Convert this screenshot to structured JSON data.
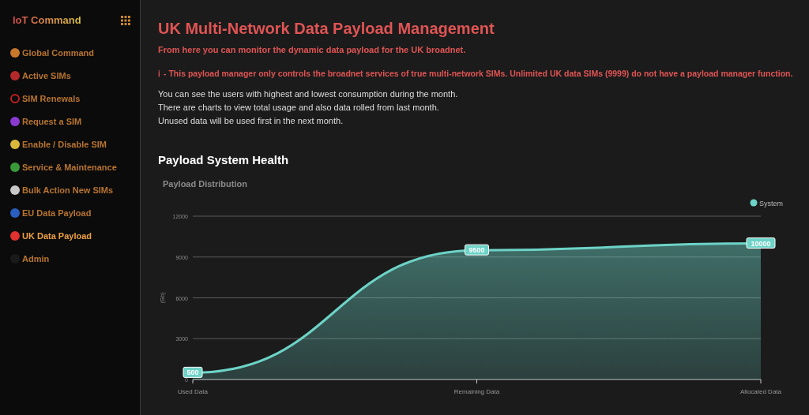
{
  "sidebar": {
    "brand": "IoT Command",
    "items": [
      {
        "label": "Global Command",
        "kind": "dot",
        "color": "#c8782a",
        "selected": false
      },
      {
        "label": "Active SIMs",
        "kind": "dot",
        "color": "#b42a2a",
        "selected": false
      },
      {
        "label": "SIM Renewals",
        "kind": "ring",
        "color": "#c02020",
        "selected": false
      },
      {
        "label": "Request a SIM",
        "kind": "dot",
        "color": "#8a3ad0",
        "selected": false
      },
      {
        "label": "Enable / Disable SIM",
        "kind": "dot",
        "color": "#d8b83a",
        "selected": false
      },
      {
        "label": "Service & Maintenance",
        "kind": "dot",
        "color": "#3a9a3a",
        "selected": false
      },
      {
        "label": "Bulk Action New SIMs",
        "kind": "dot",
        "color": "#c8c8c8",
        "selected": false
      },
      {
        "label": "EU Data Payload",
        "kind": "dot",
        "color": "#2a5ec0",
        "selected": false
      },
      {
        "label": "UK Data Payload",
        "kind": "dot",
        "color": "#e03030",
        "selected": true
      },
      {
        "label": "Admin",
        "kind": "dot",
        "color": "#1a1a1a",
        "selected": false
      }
    ]
  },
  "page": {
    "title": "UK Multi-Network Data Payload Management",
    "intro": "From here you can monitor the dynamic data payload for the UK broadnet.",
    "note_icon": "ℹ",
    "note": "- This payload manager only controls the broadnet services of true multi-network SIMs. Unlimited UK data SIMs (9999) do not have a payload manager function.",
    "lines": [
      "You can see the users with highest and lowest consumption during the month.",
      "There are charts to view total usage and also data rolled from last month.",
      "Unused data will be used first in the next month."
    ]
  },
  "health": {
    "heading": "Payload System Health",
    "chart_data": {
      "type": "area",
      "title": "Payload Distribution",
      "ylabel": "(Gb)",
      "categories": [
        "Used Data",
        "Remaining Data",
        "Allocated Data"
      ],
      "series": [
        {
          "name": "System",
          "color": "#6dd3c7",
          "values": [
            500,
            9500,
            10000
          ]
        }
      ],
      "ylim": [
        0,
        12000
      ],
      "grid": true,
      "yticks": [
        0,
        3000,
        6000,
        9000,
        12000
      ],
      "data_labels": true
    }
  }
}
